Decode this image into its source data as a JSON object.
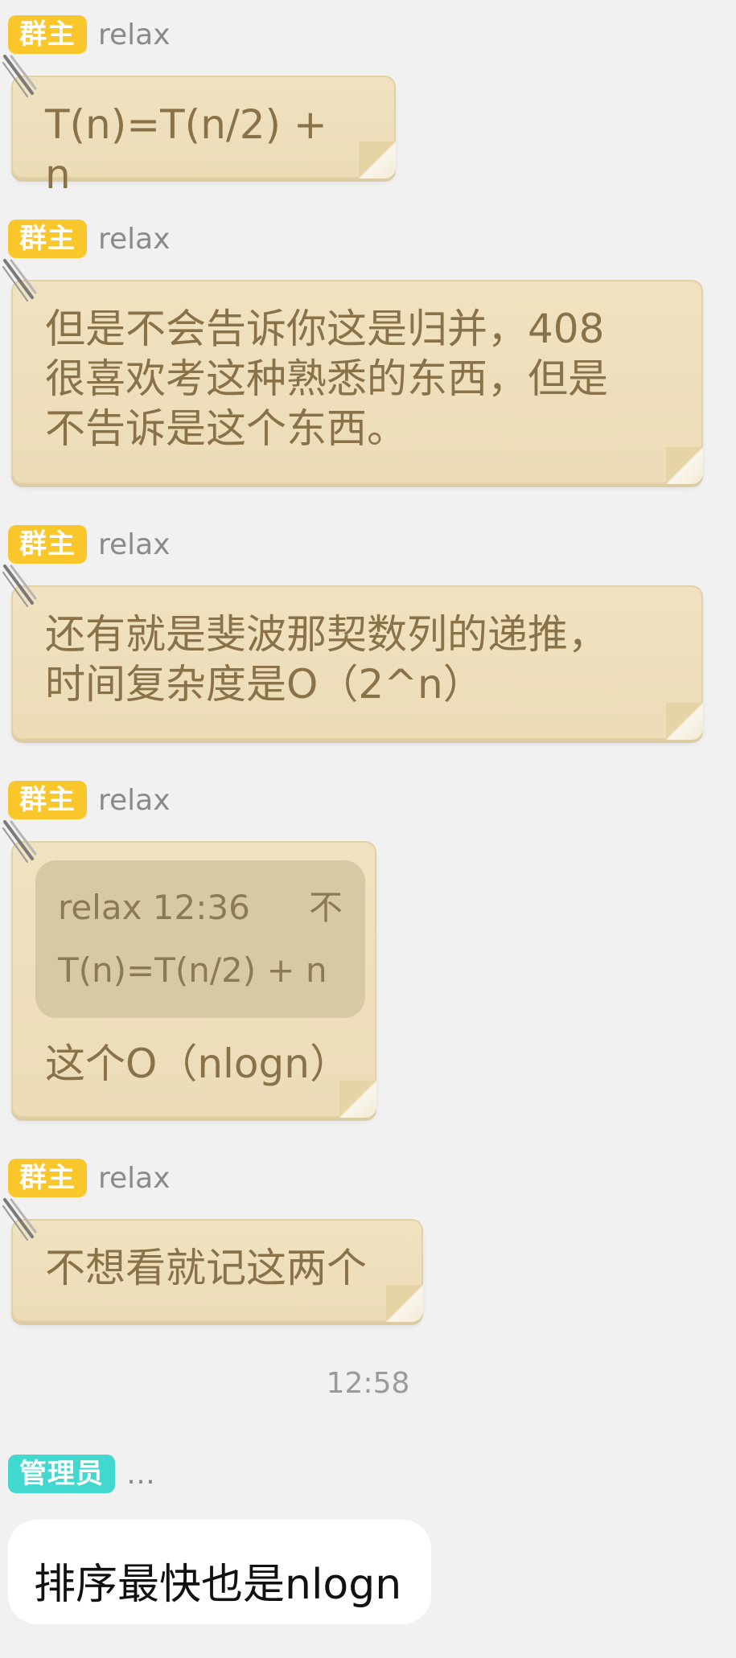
{
  "badges": {
    "owner": "群主",
    "admin": "管理员"
  },
  "messages": [
    {
      "sender": "relax",
      "text": "T(n)=T(n/2) + n"
    },
    {
      "sender": "relax",
      "text_lines": [
        "但是不会告诉你这是归并，408",
        "很喜欢考这种熟悉的东西，但是",
        "不告诉是这个东西。"
      ]
    },
    {
      "sender": "relax",
      "text_lines": [
        "还有就是斐波那契数列的递推，",
        "时间复杂度是O（2^n）"
      ]
    },
    {
      "sender": "relax",
      "quote": {
        "author_time": "relax 12:36",
        "arrow": "不",
        "text": "T(n)=T(n/2) + n"
      },
      "text": "这个O（nlogn）"
    },
    {
      "sender": "relax",
      "text": "不想看就记这两个"
    }
  ],
  "separator_time": "12:58",
  "admin_message": {
    "sender": "…",
    "text": "排序最快也是nlogn"
  },
  "colors": {
    "owner_badge": "#f9c72c",
    "admin_badge": "#41d8cf",
    "sticky_bg": "#ecdcb8",
    "sticky_text": "#8a7248"
  }
}
